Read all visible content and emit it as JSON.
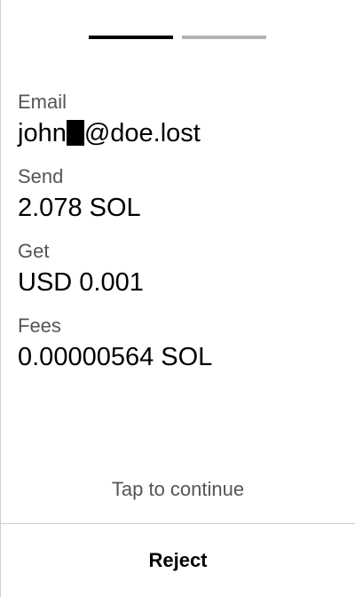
{
  "progress": {
    "total_steps": 2,
    "current_step": 1
  },
  "fields": {
    "email": {
      "label": "Email",
      "value_prefix": "john",
      "value_suffix": "@doe.lost"
    },
    "send": {
      "label": "Send",
      "value": "2.078 SOL"
    },
    "get": {
      "label": "Get",
      "value": "USD 0.001"
    },
    "fees": {
      "label": "Fees",
      "value": "0.00000564 SOL"
    }
  },
  "tap_hint": "Tap to continue",
  "reject_label": "Reject",
  "colors": {
    "progress_active": "#000000",
    "progress_inactive": "#b3b3b3",
    "label_text": "#555555",
    "divider": "#cfcfcf"
  }
}
